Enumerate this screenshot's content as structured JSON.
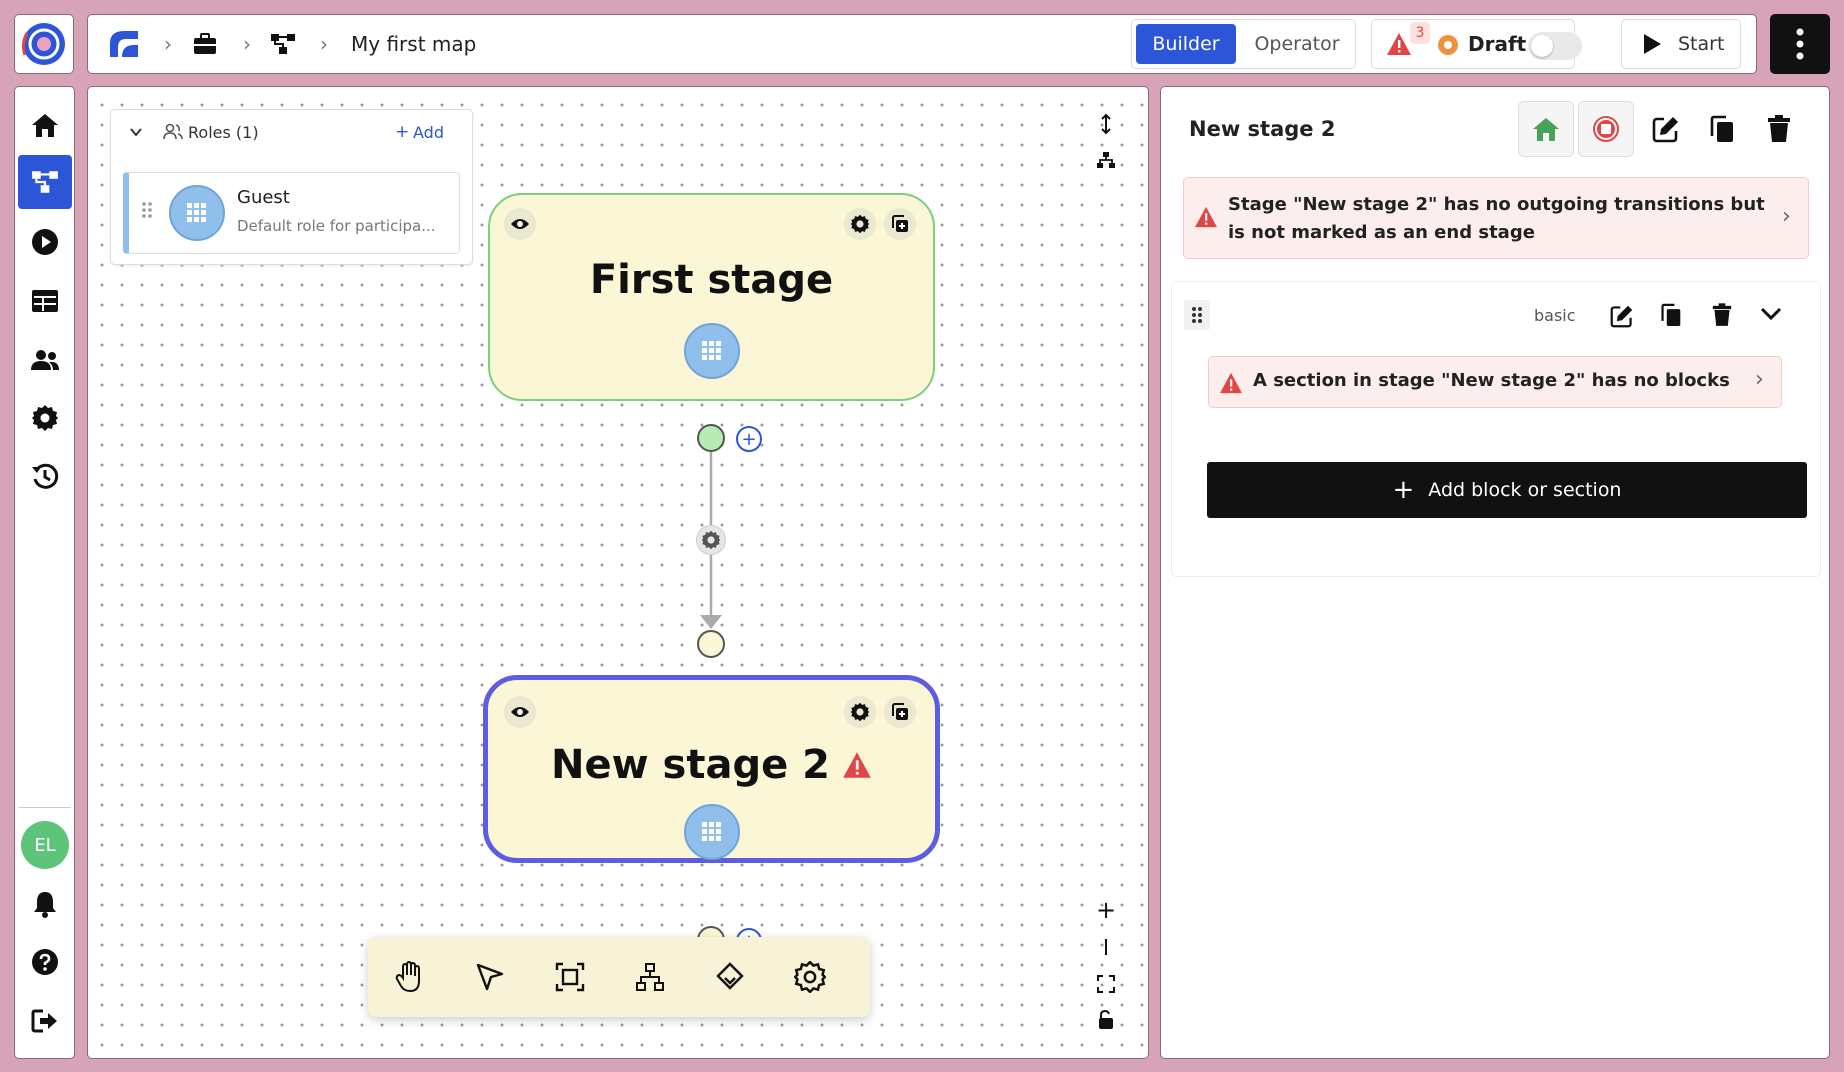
{
  "header": {
    "breadcrumb_title": "My first map",
    "mode_tabs": {
      "builder": "Builder",
      "operator": "Operator"
    },
    "issues_count": "3",
    "status_label": "Draft",
    "start_label": "Start"
  },
  "sidebar": {
    "items": [
      "home-icon",
      "map-builder-icon",
      "play-icon",
      "table-icon",
      "users-icon",
      "settings-icon",
      "history-icon"
    ],
    "user_initials": "EL",
    "bottom": [
      "bell-icon",
      "help-icon",
      "logout-icon"
    ]
  },
  "roles": {
    "header": "Roles (1)",
    "add_label": "Add",
    "items": [
      {
        "name": "Guest",
        "description": "Default role for participa..."
      }
    ]
  },
  "canvas": {
    "nodes": [
      {
        "title": "First stage",
        "selected": false,
        "warning": false
      },
      {
        "title": "New stage 2",
        "selected": true,
        "warning": true
      }
    ],
    "toolbar": [
      "hand-tool-icon",
      "select-pointer-icon",
      "frame-icon",
      "hierarchy-icon",
      "stage-diamond-icon",
      "gear-icon"
    ],
    "zoom_controls": [
      "zoom-in-icon",
      "zoom-out-icon",
      "fit-view-icon",
      "lock-icon"
    ]
  },
  "panel": {
    "title": "New stage 2",
    "stage_warning": "Stage \"New stage 2\" has no outgoing transitions but is not marked as an end stage",
    "section": {
      "type_label": "basic",
      "warning": "A section in stage \"New stage 2\" has no blocks"
    },
    "add_button": "Add block or section"
  },
  "colors": {
    "accent": "#2c55d8",
    "stage_fill": "#fbf6d5",
    "start_stage_border": "#7ccf7c",
    "selected_stage_border": "#5c5de0",
    "warning_red": "#e14646",
    "warning_bg": "#fdeeee",
    "primary_dark": "#111111"
  }
}
